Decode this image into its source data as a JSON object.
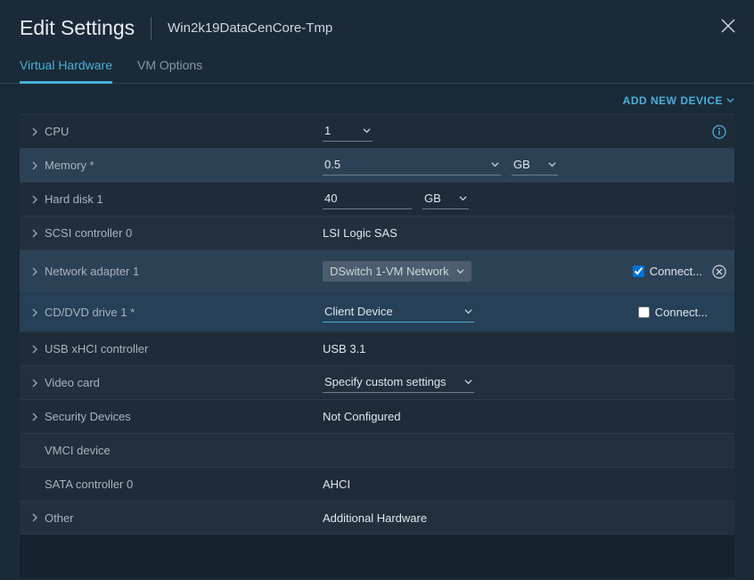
{
  "header": {
    "title": "Edit Settings",
    "vm_name": "Win2k19DataCenCore-Tmp"
  },
  "tabs": {
    "hardware": "Virtual Hardware",
    "options": "VM Options"
  },
  "toolbar": {
    "add_device": "ADD NEW DEVICE"
  },
  "rows": {
    "cpu": {
      "label": "CPU",
      "value": "1"
    },
    "memory": {
      "label": "Memory *",
      "value": "0.5",
      "unit": "GB"
    },
    "hd1": {
      "label": "Hard disk 1",
      "value": "40",
      "unit": "GB"
    },
    "scsi0": {
      "label": "SCSI controller 0",
      "value": "LSI Logic SAS"
    },
    "net1": {
      "label": "Network adapter 1",
      "value": "DSwitch 1-VM Network",
      "connect": "Connect..."
    },
    "cd1": {
      "label": "CD/DVD drive 1 *",
      "value": "Client Device",
      "connect": "Connect..."
    },
    "usb": {
      "label": "USB xHCI controller",
      "value": "USB 3.1"
    },
    "video": {
      "label": "Video card",
      "value": "Specify custom settings"
    },
    "security": {
      "label": "Security Devices",
      "value": "Not Configured"
    },
    "vmci": {
      "label": "VMCI device"
    },
    "sata0": {
      "label": "SATA controller 0",
      "value": "AHCI"
    },
    "other": {
      "label": "Other",
      "value": "Additional Hardware"
    }
  }
}
